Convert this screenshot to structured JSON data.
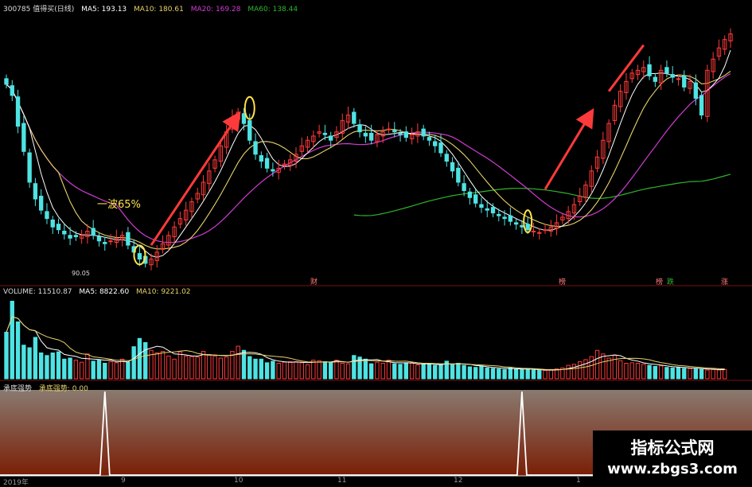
{
  "header_main": {
    "code_name": "300785 值得买(日线)",
    "ma5": "MA5: 193.13",
    "ma10": "MA10: 180.61",
    "ma20": "MA20: 169.28",
    "ma60": "MA60: 138.44"
  },
  "header_vol": {
    "name": "VOLUME: 11510.87",
    "ma5": "MA5: 8822.60",
    "ma10": "MA10: 9221.02"
  },
  "header_ind": {
    "name": "承底强势",
    "value_label": "承底强势: 0.00"
  },
  "annotations": {
    "wave": "一波65%",
    "low_price": "90.05"
  },
  "event_marks": [
    "财",
    "榜",
    "榜",
    "跌",
    "涨"
  ],
  "x_axis_labels": [
    "2019年",
    "9",
    "10",
    "11",
    "12",
    "1"
  ],
  "watermark": {
    "line1": "指标公式网",
    "line2": "www.zbgs3.com"
  },
  "colors": {
    "up": "#ff3a3a",
    "down": "#4fe3e3",
    "ma5": "#ffffff",
    "ma10": "#e6d36a",
    "ma20": "#d23cd2",
    "ma60": "#2fb52f",
    "highlight": "#ffe24a",
    "arrow": "#ff3a3a"
  },
  "chart_data": [
    {
      "type": "candlestick",
      "title": "300785 值得买(日线)",
      "series_close": [
        220,
        212,
        190,
        172,
        150,
        138,
        130,
        124,
        118,
        116,
        113,
        110,
        111,
        112,
        115,
        112,
        108,
        106,
        108,
        110,
        112,
        105,
        100,
        95,
        92,
        95,
        100,
        106,
        112,
        118,
        124,
        130,
        136,
        142,
        150,
        158,
        166,
        176,
        186,
        196,
        200,
        192,
        180,
        170,
        165,
        160,
        158,
        160,
        163,
        166,
        170,
        176,
        180,
        183,
        186,
        184,
        180,
        186,
        194,
        198,
        192,
        186,
        183,
        180,
        184,
        186,
        188,
        186,
        184,
        182,
        184,
        186,
        183,
        180,
        176,
        171,
        165,
        158,
        150,
        144,
        139,
        135,
        132,
        130,
        128,
        126,
        124,
        122,
        120,
        118,
        116,
        115,
        114,
        116,
        118,
        121,
        125,
        129,
        134,
        140,
        148,
        158,
        168,
        180,
        192,
        205,
        215,
        222,
        228,
        230,
        232,
        226,
        222,
        230,
        228,
        225,
        224,
        218,
        222,
        210,
        198,
        230,
        238,
        246,
        252,
        256
      ]
    },
    {
      "type": "bar",
      "title": "VOLUME",
      "series": [
        {
          "name": "VOLUME",
          "values": [
            9000,
            15000,
            11000,
            6500,
            6000,
            8000,
            5000,
            4500,
            5000,
            5200,
            3800,
            4000,
            3600,
            3200,
            4800,
            3400,
            3600,
            3000,
            3300,
            3100,
            3800,
            3200,
            6200,
            7800,
            7000,
            5500,
            5000,
            5300,
            4400,
            3800,
            5200,
            4400,
            4300,
            4200,
            5300,
            4700,
            4400,
            4000,
            4200,
            5300,
            6300,
            5500,
            4300,
            3800,
            3800,
            3100,
            3400,
            3000,
            3200,
            3300,
            3300,
            3100,
            2700,
            3600,
            3500,
            3300,
            3200,
            3600,
            3000,
            2900,
            4500,
            4200,
            3800,
            2900,
            3200,
            3000,
            3600,
            2900,
            2800,
            3100,
            3000,
            2700,
            2800,
            2900,
            2600,
            2700,
            3400,
            2700,
            3000,
            2600,
            2300,
            2200,
            2400,
            2100,
            2000,
            1900,
            1800,
            2100,
            1900,
            1800,
            1800,
            1700,
            1600,
            1600,
            1700,
            1900,
            2100,
            2600,
            2800,
            3300,
            3700,
            4300,
            5500,
            4800,
            4000,
            4500,
            3500,
            3000,
            3100,
            3000,
            2800,
            2600,
            2400,
            2500,
            2200,
            2100,
            2200,
            2000,
            2000,
            1900,
            1800,
            1700,
            1800,
            1700,
            1800
          ]
        }
      ],
      "ma5": 8822.6,
      "ma10": 9221.02
    },
    {
      "type": "line",
      "title": "承底强势",
      "values": "spikes at 2 signal days, 0 elsewhere",
      "ylim": [
        0,
        1
      ]
    }
  ]
}
